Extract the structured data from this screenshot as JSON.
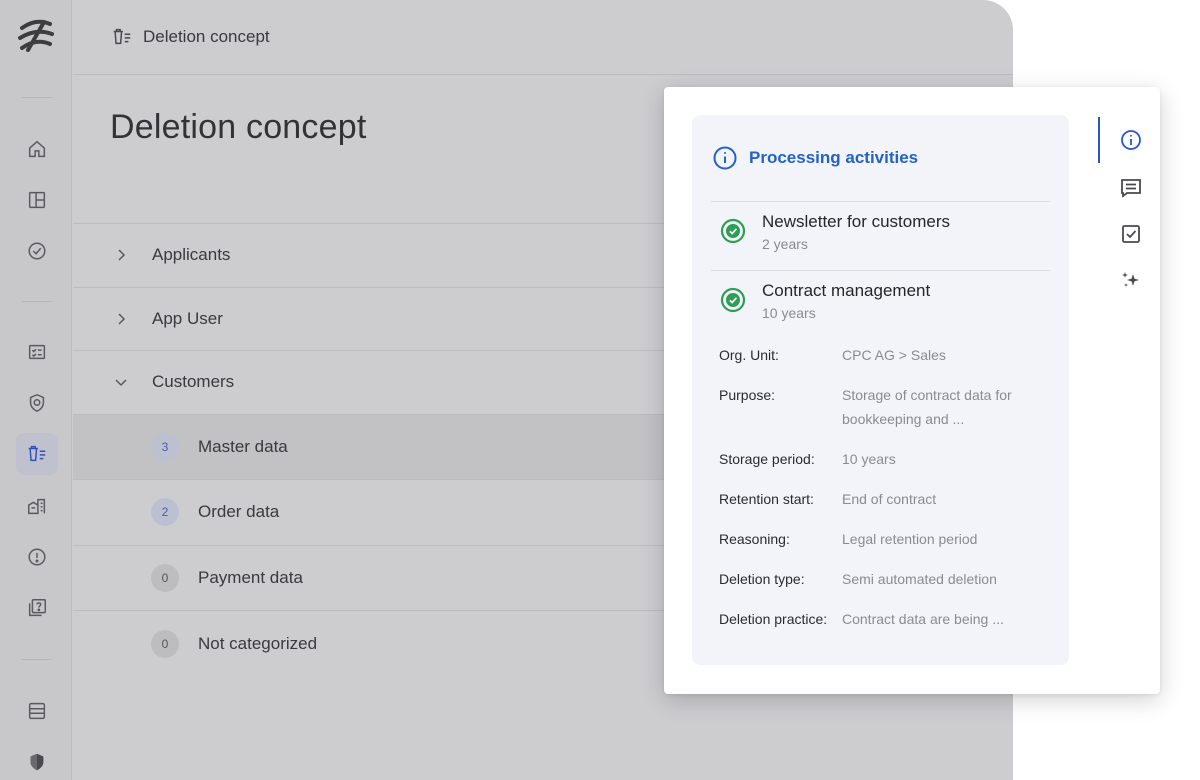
{
  "breadcrumb": {
    "label": "Deletion concept"
  },
  "page": {
    "title": "Deletion concept"
  },
  "nav_rail": {
    "icons": [
      "logo-icon",
      "home-icon",
      "dashboard-icon",
      "check-circle-icon",
      "checklist-icon",
      "shield-icon",
      "deletion-icon",
      "buildings-icon",
      "alert-icon",
      "help-icon",
      "table-icon",
      "security-shield-icon"
    ],
    "active": "deletion-icon"
  },
  "tree": {
    "groups": [
      {
        "label": "Applicants",
        "expanded": false
      },
      {
        "label": "App User",
        "expanded": false
      },
      {
        "label": "Customers",
        "expanded": true
      }
    ],
    "items": [
      {
        "count": "3",
        "label": "Master data",
        "selected": true,
        "badge_color": "#bcc1d2"
      },
      {
        "count": "2",
        "label": "Order data",
        "selected": false,
        "badge_color": "#bcc1d2"
      },
      {
        "count": "0",
        "label": "Payment data",
        "selected": false,
        "badge_color": "#bdbdc0"
      },
      {
        "count": "0",
        "label": "Not categorized",
        "selected": false,
        "badge_color": "#bdbdc0"
      }
    ]
  },
  "panel": {
    "heading": "Processing activities",
    "activities": [
      {
        "title": "Newsletter for customers",
        "period": "2 years"
      },
      {
        "title": "Contract management",
        "period": "10 years"
      }
    ],
    "details": [
      {
        "key": "Org. Unit:",
        "value": "CPC AG > Sales"
      },
      {
        "key": "Purpose:",
        "value": "Storage of contract data for bookkeeping and ..."
      },
      {
        "key": "Storage period:",
        "value": "10 years"
      },
      {
        "key": "Retention start:",
        "value": "End of contract"
      },
      {
        "key": "Reasoning:",
        "value": "Legal retention period"
      },
      {
        "key": "Deletion type:",
        "value": "Semi automated deletion"
      },
      {
        "key": "Deletion practice:",
        "value": "Contract data are being ..."
      }
    ],
    "side_tabs": [
      "info-icon",
      "comment-icon",
      "checkbox-icon",
      "sparkle-icon"
    ],
    "active_tab": "info-icon"
  },
  "colors": {
    "accent": "#2362c9",
    "success": "#2e9e55",
    "app_bg": "#cdcdd0"
  }
}
